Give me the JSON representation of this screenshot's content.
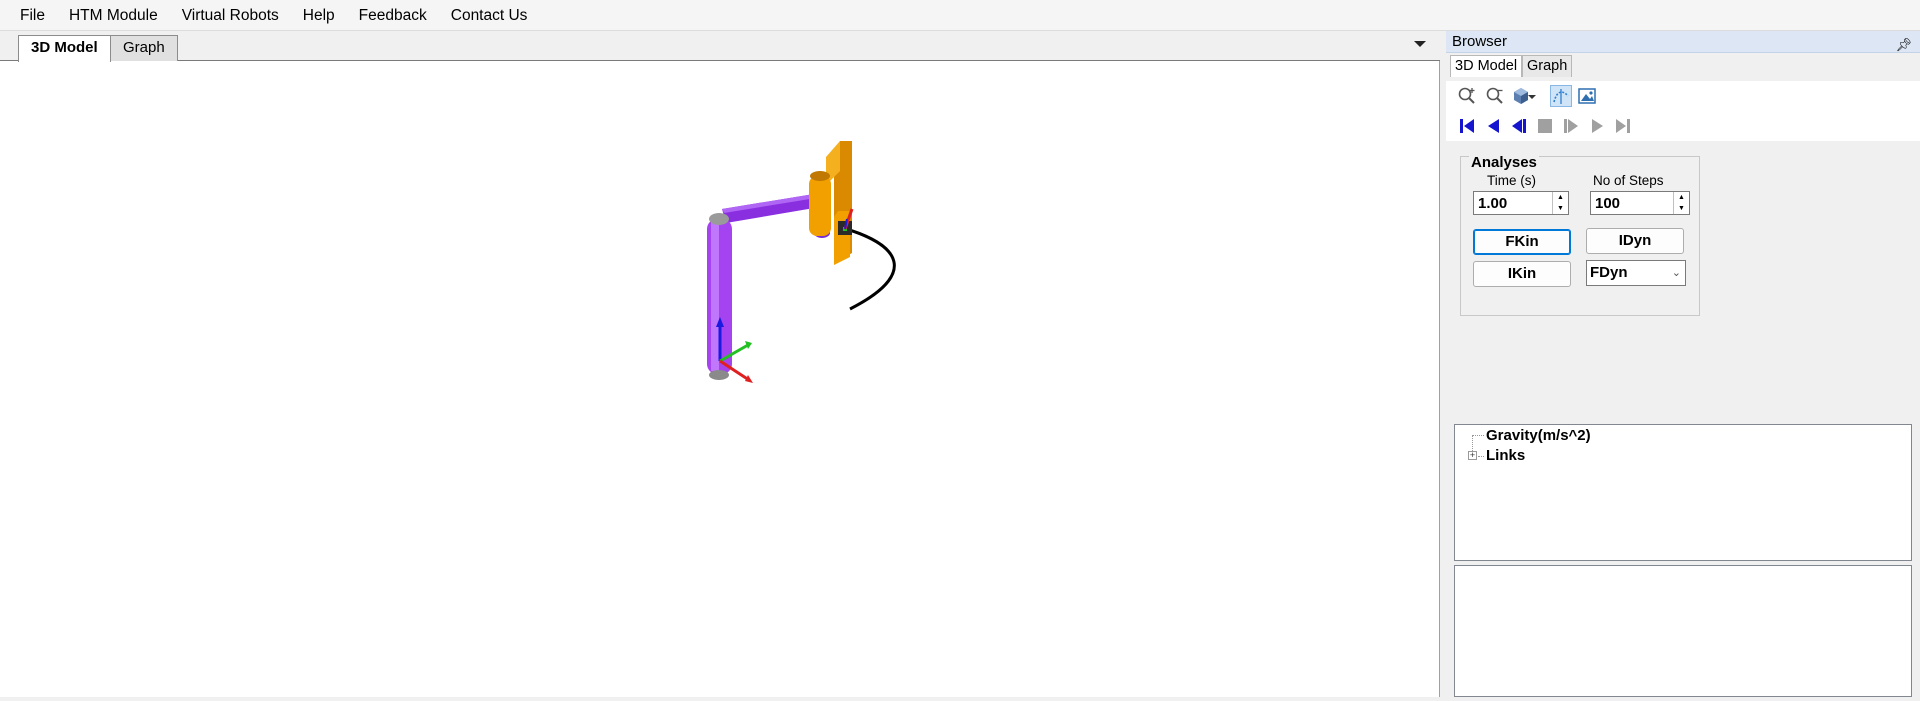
{
  "menu": {
    "items": [
      "File",
      "HTM Module",
      "Virtual Robots",
      "Help",
      "Feedback",
      "Contact Us"
    ]
  },
  "viewport": {
    "tabs": [
      "3D Model",
      "Graph"
    ],
    "active_tab": "3D Model"
  },
  "browser": {
    "title": "Browser",
    "tabs": [
      "3D Model",
      "Graph"
    ],
    "active_tab": "3D Model",
    "toolbar_icons": [
      "zoom-in-icon",
      "zoom-out-icon",
      "view-cube-icon",
      "dropdown-arrow-icon",
      "trace-path-icon",
      "snapshot-icon"
    ],
    "playback_icons": [
      "first-frame-icon",
      "play-reverse-icon",
      "step-back-icon",
      "stop-icon",
      "step-forward-icon",
      "play-icon",
      "last-frame-icon"
    ],
    "analyses": {
      "title": "Analyses",
      "time_label": "Time (s)",
      "time_value": "1.00",
      "steps_label": "No of Steps",
      "steps_value": "100",
      "buttons": {
        "fkin": "FKin",
        "idyn": "IDyn",
        "ikin": "IKin"
      },
      "fdyn_select": "FDyn"
    },
    "tree": {
      "items": [
        "Gravity(m/s^2)",
        "Links"
      ]
    }
  },
  "colors": {
    "link_purple": "#9b3ee8",
    "link_orange": "#f2a000",
    "joint_gray": "#9a9a9a",
    "trajectory": "#000000",
    "axis_x": "#e02020",
    "axis_y": "#22c022",
    "axis_z": "#1a1ae0"
  }
}
